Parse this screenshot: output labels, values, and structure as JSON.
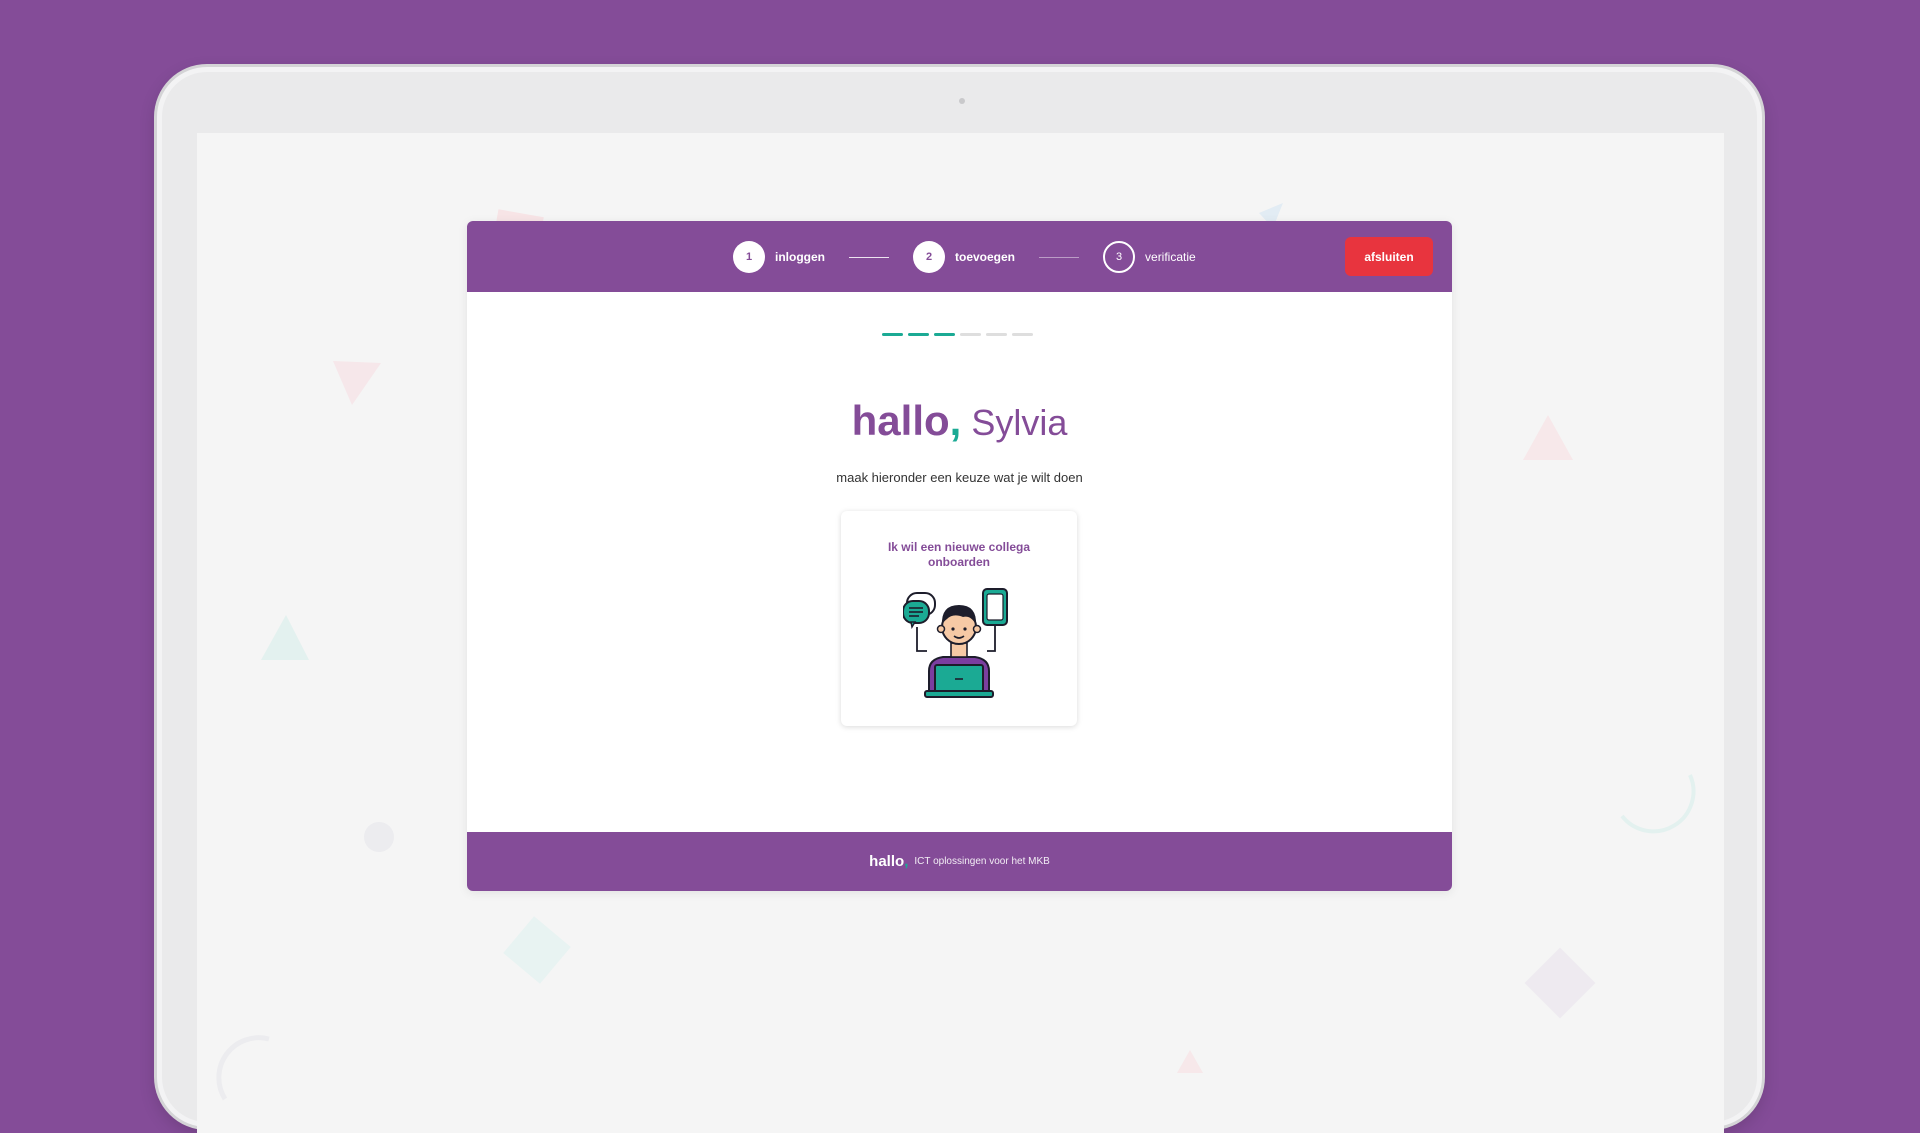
{
  "steps": [
    {
      "number": "1",
      "label": "inloggen",
      "state": "done"
    },
    {
      "number": "2",
      "label": "toevoegen",
      "state": "active"
    },
    {
      "number": "3",
      "label": "verificatie",
      "state": "todo"
    }
  ],
  "header": {
    "close_label": "afsluiten"
  },
  "progress": {
    "completed": 3,
    "total": 6
  },
  "main": {
    "greeting_word": "hallo",
    "greeting_comma": ",",
    "user_name": "Sylvia",
    "subtitle": "maak hieronder een keuze wat je wilt doen"
  },
  "option_card": {
    "title": "Ik wil een nieuwe collega onboarden",
    "icon": "onboarding-person-icon"
  },
  "footer": {
    "logo": "hallo",
    "logo_comma": ",",
    "tagline": "ICT oplossingen voor het MKB"
  },
  "colors": {
    "brand_purple": "#844C98",
    "accent_teal": "#1BAA94",
    "close_red": "#E8343E"
  }
}
